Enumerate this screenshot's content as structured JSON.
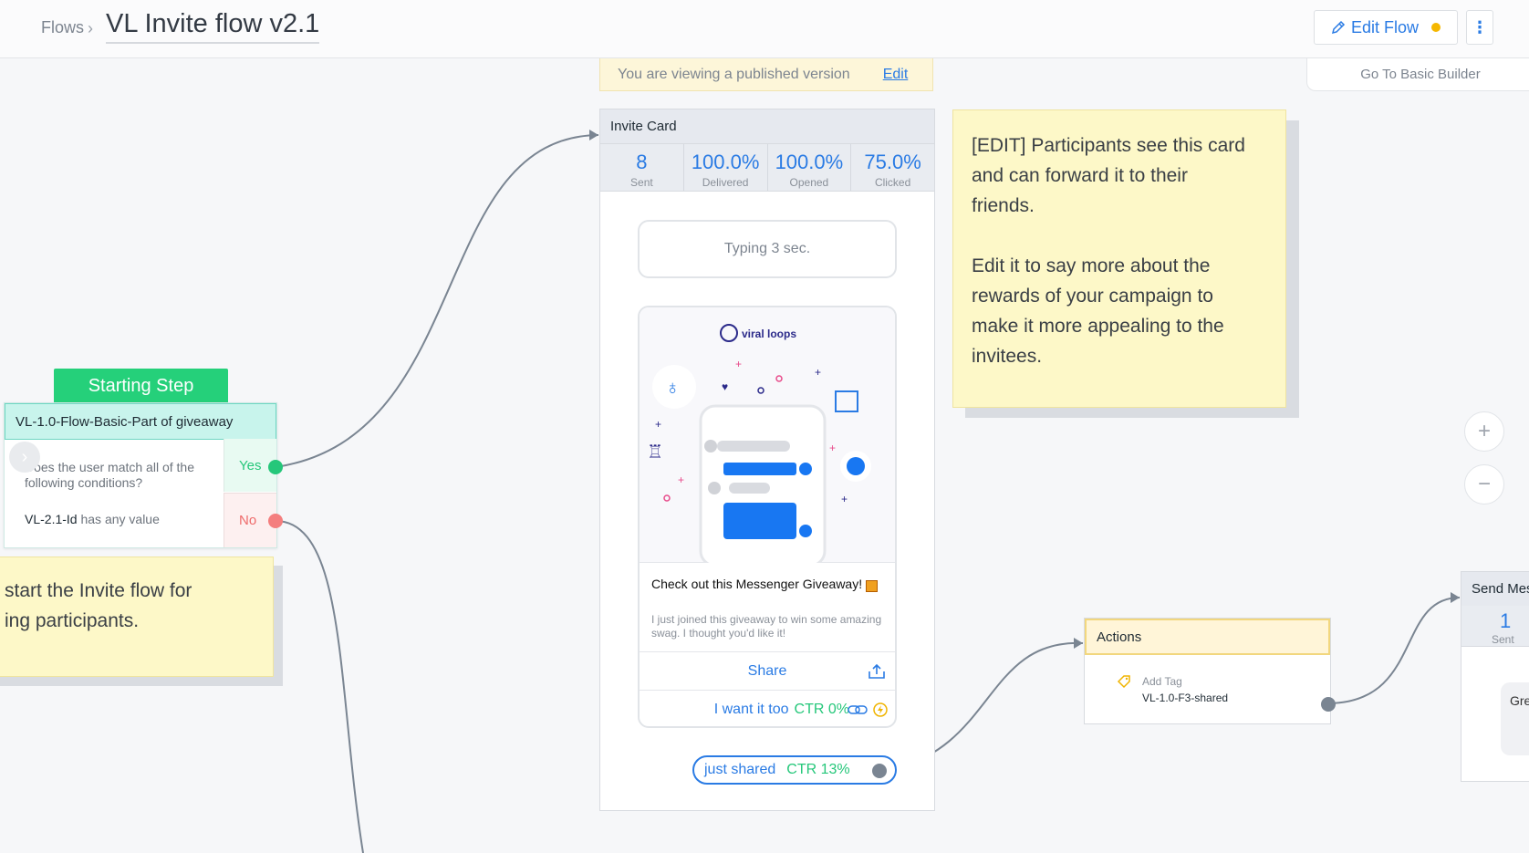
{
  "header": {
    "breadcrumb": "Flows",
    "title": "VL Invite flow v2.1",
    "edit_flow_label": "Edit Flow",
    "go_basic_builder": "Go To Basic Builder"
  },
  "banner": {
    "text": "You are viewing a published version",
    "edit_label": "Edit"
  },
  "starting_step": {
    "label": "Starting Step",
    "node_title": "VL-1.0-Flow-Basic-Part of giveaway",
    "question": "Does the user match all of the following conditions?",
    "rule_field": "VL-2.1-Id",
    "rule_op": "has any value",
    "yes_label": "Yes",
    "no_label": "No"
  },
  "note_left": {
    "line1": "start the Invite flow for",
    "line2": "ing participants."
  },
  "note_right": {
    "line1": "[EDIT] Participants see this card",
    "line2": "and can forward it to their",
    "line3": "friends.",
    "line4": "Edit it to say more about the",
    "line5": "rewards of your campaign to",
    "line6": "make it more appealing to the",
    "line7": "invitees."
  },
  "invite_card": {
    "title": "Invite Card",
    "stats": [
      {
        "value": "8",
        "label": "Sent"
      },
      {
        "value": "100.0%",
        "label": "Delivered"
      },
      {
        "value": "100.0%",
        "label": "Opened"
      },
      {
        "value": "75.0%",
        "label": "Clicked"
      }
    ],
    "typing": "Typing 3 sec.",
    "brand": "viral loops",
    "msg_title": "Check out this Messenger Giveaway!",
    "msg_desc": "I just joined this giveaway to win some amazing swag. I thought you'd like it!",
    "share_label": "Share",
    "want_label": "I want it too",
    "want_ctr": "CTR 0%",
    "shared_label": "just shared",
    "shared_ctr": "CTR 13%"
  },
  "actions": {
    "title": "Actions",
    "tag_label": "Add Tag",
    "tag_value": "VL-1.0-F3-shared"
  },
  "send_message": {
    "title": "Send Mes",
    "sent_value": "1",
    "sent_label": "Sent",
    "bubble_text": "Gre"
  },
  "zoom": {
    "in": "+",
    "out": "−"
  },
  "icons": {
    "chevron": "chevron-right-icon",
    "pen": "pen-icon",
    "more": "more-vertical-icon",
    "share": "share-upload-icon",
    "link": "link-icon",
    "bolt": "bolt-icon",
    "tag": "tag-icon",
    "gift": "gift-emoji-icon"
  },
  "colors": {
    "accent": "#2a7be4",
    "start_green": "#25d07a",
    "yes_green": "#25c77a",
    "no_red": "#ee6b6b",
    "status_dot": "#f5b700",
    "note_bg": "#fdf8c8"
  }
}
